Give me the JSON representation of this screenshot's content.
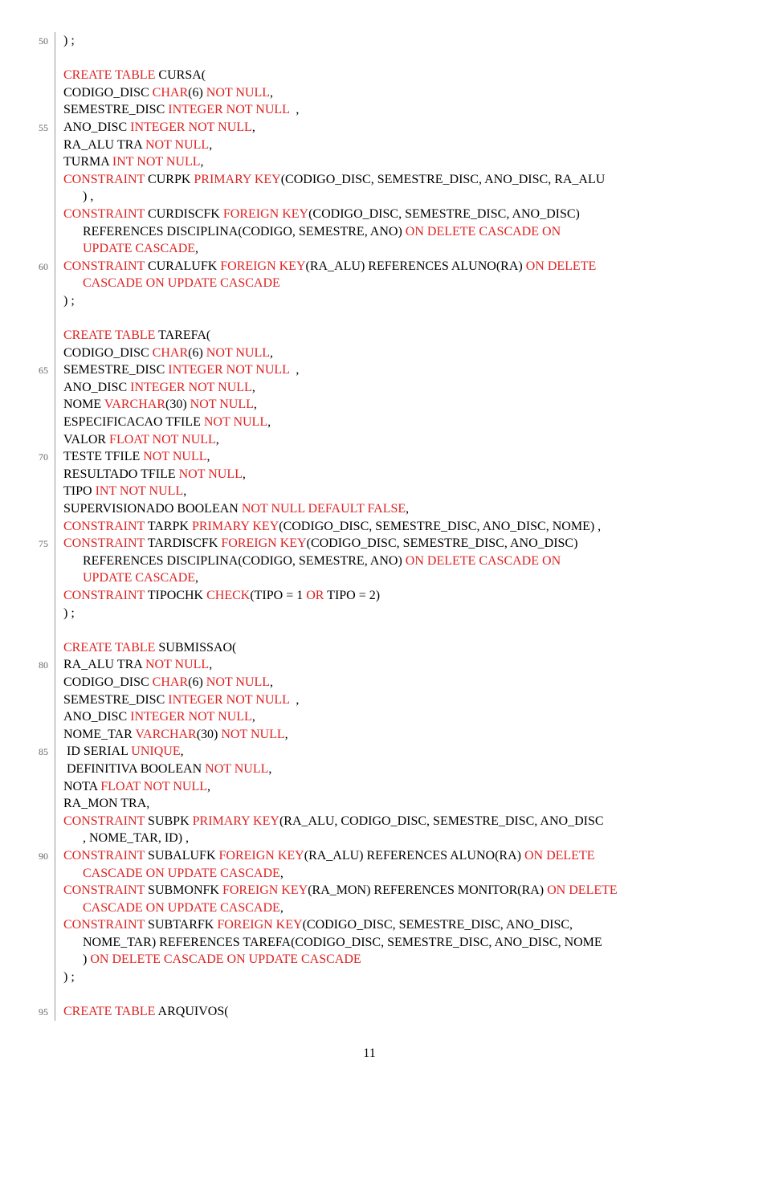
{
  "page_number": "11",
  "lines": [
    {
      "n": "50",
      "content": [
        {
          "t": ") ;",
          "c": ""
        }
      ]
    },
    {
      "n": "",
      "content": []
    },
    {
      "n": "",
      "content": [
        {
          "t": "CREATE TABLE",
          "c": "kw"
        },
        {
          "t": " CURSA(",
          "c": ""
        }
      ]
    },
    {
      "n": "",
      "content": [
        {
          "t": "CODIGO_DISC ",
          "c": ""
        },
        {
          "t": "CHAR",
          "c": "kw"
        },
        {
          "t": "(6) ",
          "c": ""
        },
        {
          "t": "NOT NULL",
          "c": "kw"
        },
        {
          "t": ",",
          "c": ""
        }
      ]
    },
    {
      "n": "",
      "content": [
        {
          "t": "SEMESTRE_DISC ",
          "c": ""
        },
        {
          "t": "INTEGER NOT NULL",
          "c": "kw"
        },
        {
          "t": "  ,",
          "c": ""
        }
      ]
    },
    {
      "n": "55",
      "content": [
        {
          "t": "ANO_DISC ",
          "c": ""
        },
        {
          "t": "INTEGER NOT NULL",
          "c": "kw"
        },
        {
          "t": ",",
          "c": ""
        }
      ]
    },
    {
      "n": "",
      "content": [
        {
          "t": "RA_ALU TRA ",
          "c": ""
        },
        {
          "t": "NOT NULL",
          "c": "kw"
        },
        {
          "t": ",",
          "c": ""
        }
      ]
    },
    {
      "n": "",
      "content": [
        {
          "t": "TURMA ",
          "c": ""
        },
        {
          "t": "INT NOT NULL",
          "c": "kw"
        },
        {
          "t": ",",
          "c": ""
        }
      ]
    },
    {
      "n": "",
      "content": [
        {
          "t": "CONSTRAINT",
          "c": "kw"
        },
        {
          "t": " CURPK ",
          "c": ""
        },
        {
          "t": "PRIMARY KEY",
          "c": "kw"
        },
        {
          "t": "(CODIGO_DISC, SEMESTRE_DISC, ANO_DISC, RA_ALU",
          "c": ""
        }
      ]
    },
    {
      "n": "",
      "content": [
        {
          "t": "      ) ,",
          "c": ""
        }
      ]
    },
    {
      "n": "",
      "content": [
        {
          "t": "CONSTRAINT",
          "c": "kw"
        },
        {
          "t": " CURDISCFK ",
          "c": ""
        },
        {
          "t": "FOREIGN KEY",
          "c": "kw"
        },
        {
          "t": "(CODIGO_DISC, SEMESTRE_DISC, ANO_DISC)",
          "c": ""
        }
      ]
    },
    {
      "n": "",
      "content": [
        {
          "t": "      REFERENCES DISCIPLINA(CODIGO, SEMESTRE, ANO) ",
          "c": ""
        },
        {
          "t": "ON DELETE CASCADE ON",
          "c": "kw"
        }
      ]
    },
    {
      "n": "",
      "content": [
        {
          "t": "      ",
          "c": ""
        },
        {
          "t": "UPDATE CASCADE",
          "c": "kw"
        },
        {
          "t": ",",
          "c": ""
        }
      ]
    },
    {
      "n": "60",
      "content": [
        {
          "t": "CONSTRAINT",
          "c": "kw"
        },
        {
          "t": " CURALUFK ",
          "c": ""
        },
        {
          "t": "FOREIGN KEY",
          "c": "kw"
        },
        {
          "t": "(RA_ALU) REFERENCES ALUNO(RA) ",
          "c": ""
        },
        {
          "t": "ON DELETE",
          "c": "kw"
        }
      ]
    },
    {
      "n": "",
      "content": [
        {
          "t": "      ",
          "c": ""
        },
        {
          "t": "CASCADE ON UPDATE CASCADE",
          "c": "kw"
        }
      ]
    },
    {
      "n": "",
      "content": [
        {
          "t": ") ;",
          "c": ""
        }
      ]
    },
    {
      "n": "",
      "content": []
    },
    {
      "n": "",
      "content": [
        {
          "t": "CREATE TABLE",
          "c": "kw"
        },
        {
          "t": " TAREFA(",
          "c": ""
        }
      ]
    },
    {
      "n": "",
      "content": [
        {
          "t": "CODIGO_DISC ",
          "c": ""
        },
        {
          "t": "CHAR",
          "c": "kw"
        },
        {
          "t": "(6) ",
          "c": ""
        },
        {
          "t": "NOT NULL",
          "c": "kw"
        },
        {
          "t": ",",
          "c": ""
        }
      ]
    },
    {
      "n": "65",
      "content": [
        {
          "t": "SEMESTRE_DISC ",
          "c": ""
        },
        {
          "t": "INTEGER NOT NULL",
          "c": "kw"
        },
        {
          "t": "  ,",
          "c": ""
        }
      ]
    },
    {
      "n": "",
      "content": [
        {
          "t": "ANO_DISC ",
          "c": ""
        },
        {
          "t": "INTEGER NOT NULL",
          "c": "kw"
        },
        {
          "t": ",",
          "c": ""
        }
      ]
    },
    {
      "n": "",
      "content": [
        {
          "t": "NOME ",
          "c": ""
        },
        {
          "t": "VARCHAR",
          "c": "kw"
        },
        {
          "t": "(30) ",
          "c": ""
        },
        {
          "t": "NOT NULL",
          "c": "kw"
        },
        {
          "t": ",",
          "c": ""
        }
      ]
    },
    {
      "n": "",
      "content": [
        {
          "t": "ESPECIFICACAO TFILE ",
          "c": ""
        },
        {
          "t": "NOT NULL",
          "c": "kw"
        },
        {
          "t": ",",
          "c": ""
        }
      ]
    },
    {
      "n": "",
      "content": [
        {
          "t": "VALOR ",
          "c": ""
        },
        {
          "t": "FLOAT NOT NULL",
          "c": "kw"
        },
        {
          "t": ",",
          "c": ""
        }
      ]
    },
    {
      "n": "70",
      "content": [
        {
          "t": "TESTE TFILE ",
          "c": ""
        },
        {
          "t": "NOT NULL",
          "c": "kw"
        },
        {
          "t": ",",
          "c": ""
        }
      ]
    },
    {
      "n": "",
      "content": [
        {
          "t": "RESULTADO TFILE ",
          "c": ""
        },
        {
          "t": "NOT NULL",
          "c": "kw"
        },
        {
          "t": ",",
          "c": ""
        }
      ]
    },
    {
      "n": "",
      "content": [
        {
          "t": "TIPO ",
          "c": ""
        },
        {
          "t": "INT NOT NULL",
          "c": "kw"
        },
        {
          "t": ",",
          "c": ""
        }
      ]
    },
    {
      "n": "",
      "content": [
        {
          "t": "SUPERVISIONADO BOOLEAN ",
          "c": ""
        },
        {
          "t": "NOT NULL DEFAULT FALSE",
          "c": "kw"
        },
        {
          "t": ",",
          "c": ""
        }
      ]
    },
    {
      "n": "",
      "content": [
        {
          "t": "CONSTRAINT",
          "c": "kw"
        },
        {
          "t": " TARPK ",
          "c": ""
        },
        {
          "t": "PRIMARY KEY",
          "c": "kw"
        },
        {
          "t": "(CODIGO_DISC, SEMESTRE_DISC, ANO_DISC, NOME) ,",
          "c": ""
        }
      ]
    },
    {
      "n": "75",
      "content": [
        {
          "t": "CONSTRAINT",
          "c": "kw"
        },
        {
          "t": " TARDISCFK ",
          "c": ""
        },
        {
          "t": "FOREIGN KEY",
          "c": "kw"
        },
        {
          "t": "(CODIGO_DISC, SEMESTRE_DISC, ANO_DISC)",
          "c": ""
        }
      ]
    },
    {
      "n": "",
      "content": [
        {
          "t": "      REFERENCES DISCIPLINA(CODIGO, SEMESTRE, ANO) ",
          "c": ""
        },
        {
          "t": "ON DELETE CASCADE ON",
          "c": "kw"
        }
      ]
    },
    {
      "n": "",
      "content": [
        {
          "t": "      ",
          "c": ""
        },
        {
          "t": "UPDATE CASCADE",
          "c": "kw"
        },
        {
          "t": ",",
          "c": ""
        }
      ]
    },
    {
      "n": "",
      "content": [
        {
          "t": "CONSTRAINT",
          "c": "kw"
        },
        {
          "t": " TIPOCHK ",
          "c": ""
        },
        {
          "t": "CHECK",
          "c": "kw"
        },
        {
          "t": "(TIPO = 1 ",
          "c": ""
        },
        {
          "t": "OR",
          "c": "kw"
        },
        {
          "t": " TIPO = 2)",
          "c": ""
        }
      ]
    },
    {
      "n": "",
      "content": [
        {
          "t": ") ;",
          "c": ""
        }
      ]
    },
    {
      "n": "",
      "content": []
    },
    {
      "n": "",
      "content": [
        {
          "t": "CREATE TABLE",
          "c": "kw"
        },
        {
          "t": " SUBMISSAO(",
          "c": ""
        }
      ]
    },
    {
      "n": "80",
      "content": [
        {
          "t": "RA_ALU TRA ",
          "c": ""
        },
        {
          "t": "NOT NULL",
          "c": "kw"
        },
        {
          "t": ",",
          "c": ""
        }
      ]
    },
    {
      "n": "",
      "content": [
        {
          "t": "CODIGO_DISC ",
          "c": ""
        },
        {
          "t": "CHAR",
          "c": "kw"
        },
        {
          "t": "(6) ",
          "c": ""
        },
        {
          "t": "NOT NULL",
          "c": "kw"
        },
        {
          "t": ",",
          "c": ""
        }
      ]
    },
    {
      "n": "",
      "content": [
        {
          "t": "SEMESTRE_DISC ",
          "c": ""
        },
        {
          "t": "INTEGER NOT NULL",
          "c": "kw"
        },
        {
          "t": "  ,",
          "c": ""
        }
      ]
    },
    {
      "n": "",
      "content": [
        {
          "t": "ANO_DISC ",
          "c": ""
        },
        {
          "t": "INTEGER NOT NULL",
          "c": "kw"
        },
        {
          "t": ",",
          "c": ""
        }
      ]
    },
    {
      "n": "",
      "content": [
        {
          "t": "NOME_TAR ",
          "c": ""
        },
        {
          "t": "VARCHAR",
          "c": "kw"
        },
        {
          "t": "(30) ",
          "c": ""
        },
        {
          "t": "NOT NULL",
          "c": "kw"
        },
        {
          "t": ",",
          "c": ""
        }
      ]
    },
    {
      "n": "85",
      "content": [
        {
          "t": " ID SERIAL ",
          "c": ""
        },
        {
          "t": "UNIQUE",
          "c": "kw"
        },
        {
          "t": ",",
          "c": ""
        }
      ]
    },
    {
      "n": "",
      "content": [
        {
          "t": " DEFINITIVA BOOLEAN ",
          "c": ""
        },
        {
          "t": "NOT NULL",
          "c": "kw"
        },
        {
          "t": ",",
          "c": ""
        }
      ]
    },
    {
      "n": "",
      "content": [
        {
          "t": "NOTA ",
          "c": ""
        },
        {
          "t": "FLOAT NOT NULL",
          "c": "kw"
        },
        {
          "t": ",",
          "c": ""
        }
      ]
    },
    {
      "n": "",
      "content": [
        {
          "t": "RA_MON TRA,",
          "c": ""
        }
      ]
    },
    {
      "n": "",
      "content": [
        {
          "t": "CONSTRAINT",
          "c": "kw"
        },
        {
          "t": " SUBPK ",
          "c": ""
        },
        {
          "t": "PRIMARY KEY",
          "c": "kw"
        },
        {
          "t": "(RA_ALU, CODIGO_DISC, SEMESTRE_DISC, ANO_DISC",
          "c": ""
        }
      ]
    },
    {
      "n": "",
      "content": [
        {
          "t": "      , NOME_TAR, ID) ,",
          "c": ""
        }
      ]
    },
    {
      "n": "90",
      "content": [
        {
          "t": "CONSTRAINT",
          "c": "kw"
        },
        {
          "t": " SUBALUFK ",
          "c": ""
        },
        {
          "t": "FOREIGN KEY",
          "c": "kw"
        },
        {
          "t": "(RA_ALU) REFERENCES ALUNO(RA) ",
          "c": ""
        },
        {
          "t": "ON DELETE",
          "c": "kw"
        }
      ]
    },
    {
      "n": "",
      "content": [
        {
          "t": "      ",
          "c": ""
        },
        {
          "t": "CASCADE ON UPDATE CASCADE",
          "c": "kw"
        },
        {
          "t": ",",
          "c": ""
        }
      ]
    },
    {
      "n": "",
      "content": [
        {
          "t": "CONSTRAINT",
          "c": "kw"
        },
        {
          "t": " SUBMONFK ",
          "c": ""
        },
        {
          "t": "FOREIGN KEY",
          "c": "kw"
        },
        {
          "t": "(RA_MON) REFERENCES MONITOR(RA) ",
          "c": ""
        },
        {
          "t": "ON DELETE",
          "c": "kw"
        }
      ]
    },
    {
      "n": "",
      "content": [
        {
          "t": "      ",
          "c": ""
        },
        {
          "t": "CASCADE ON UPDATE CASCADE",
          "c": "kw"
        },
        {
          "t": ",",
          "c": ""
        }
      ]
    },
    {
      "n": "",
      "content": [
        {
          "t": "CONSTRAINT",
          "c": "kw"
        },
        {
          "t": " SUBTARFK ",
          "c": ""
        },
        {
          "t": "FOREIGN KEY",
          "c": "kw"
        },
        {
          "t": "(CODIGO_DISC, SEMESTRE_DISC, ANO_DISC,",
          "c": ""
        }
      ]
    },
    {
      "n": "",
      "content": [
        {
          "t": "      NOME_TAR) REFERENCES TAREFA(CODIGO_DISC, SEMESTRE_DISC, ANO_DISC, NOME",
          "c": ""
        }
      ]
    },
    {
      "n": "",
      "content": [
        {
          "t": "      ) ",
          "c": ""
        },
        {
          "t": "ON DELETE CASCADE ON UPDATE CASCADE",
          "c": "kw"
        }
      ]
    },
    {
      "n": "",
      "content": [
        {
          "t": ") ;",
          "c": ""
        }
      ]
    },
    {
      "n": "",
      "content": []
    },
    {
      "n": "95",
      "content": [
        {
          "t": "CREATE TABLE",
          "c": "kw"
        },
        {
          "t": " ARQUIVOS(",
          "c": ""
        }
      ]
    }
  ]
}
